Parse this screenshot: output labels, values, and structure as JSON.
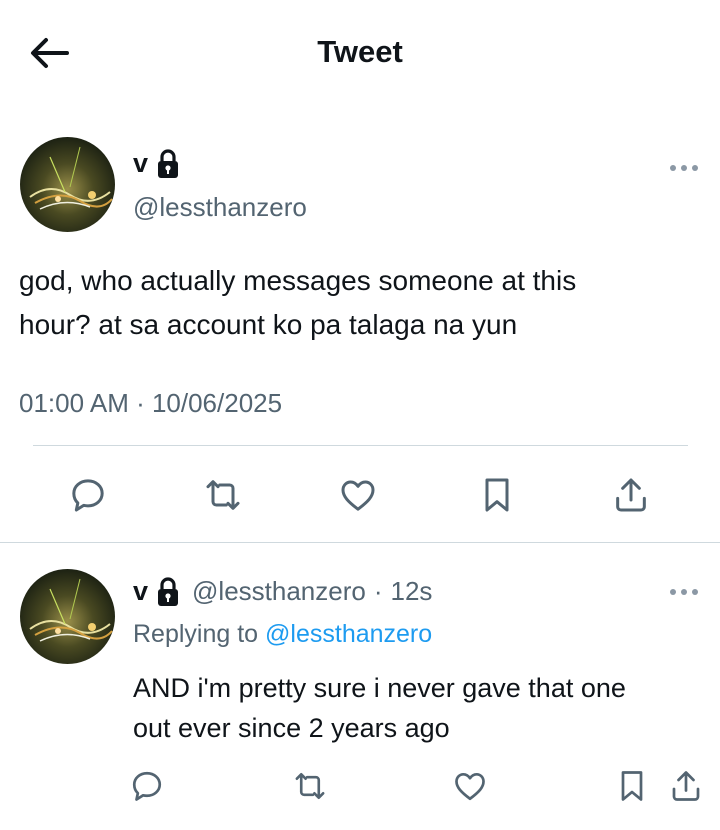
{
  "header": {
    "title": "Tweet",
    "back_icon": "arrow-left-icon"
  },
  "tweet": {
    "display_name": "v",
    "handle": "@lessthanzero",
    "protected_icon": "lock-icon",
    "text_line1": "god, who actually messages someone at this",
    "text_line2": "hour? at sa account ko pa talaga na yun",
    "timestamp": "01:00 AM · 10/06/2025",
    "actions": [
      "reply-icon",
      "retweet-icon",
      "like-icon",
      "bookmark-icon",
      "share-icon"
    ]
  },
  "reply": {
    "display_name": "v",
    "handle": "@lessthanzero",
    "separator": "·",
    "time_ago": "12s",
    "replying_prefix": "Replying to",
    "replying_to": "@lessthanzero",
    "text_line1": "AND i'm pretty sure i never gave that one",
    "text_line2": "out ever since 2 years ago",
    "actions": [
      "reply-icon",
      "retweet-icon",
      "like-icon",
      "bookmark-icon",
      "share-icon"
    ]
  },
  "colors": {
    "text_primary": "#0f1419",
    "text_secondary": "#536471",
    "link": "#1d9bf0",
    "divider": "#cfd9de"
  }
}
